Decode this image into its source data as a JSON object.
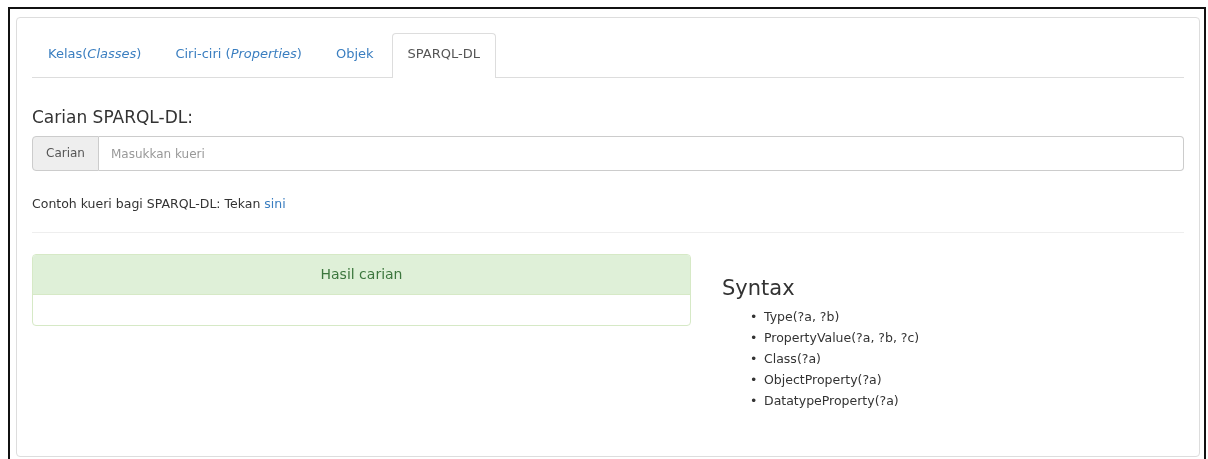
{
  "tabs": [
    {
      "label": "Kelas(*Classes*)",
      "selected": false
    },
    {
      "label": "Ciri-ciri (*Properties*)",
      "selected": false
    },
    {
      "label": "Objek",
      "selected": false
    },
    {
      "label": "SPARQL-DL",
      "selected": true
    }
  ],
  "search": {
    "heading": "Carian SPARQL-DL:",
    "addon": "Carian",
    "placeholder": "Masukkan kueri"
  },
  "example": {
    "text": "Contoh kueri bagi SPARQL-DL: Tekan",
    "link": "sini"
  },
  "results_panel": {
    "title": "Hasil carian"
  },
  "syntax": {
    "title": "Syntax",
    "items": [
      {
        "bullet": "•",
        "text": "Type(?a, ?b)"
      },
      {
        "bullet": "•",
        "text": "PropertyValue(?a, ?b, ?c)"
      },
      {
        "bullet": "•",
        "text": "Class(?a)"
      },
      {
        "bullet": "•",
        "text": "ObjectProperty(?a)"
      },
      {
        "bullet": "•",
        "text": "DatatypeProperty(?a)"
      }
    ]
  }
}
